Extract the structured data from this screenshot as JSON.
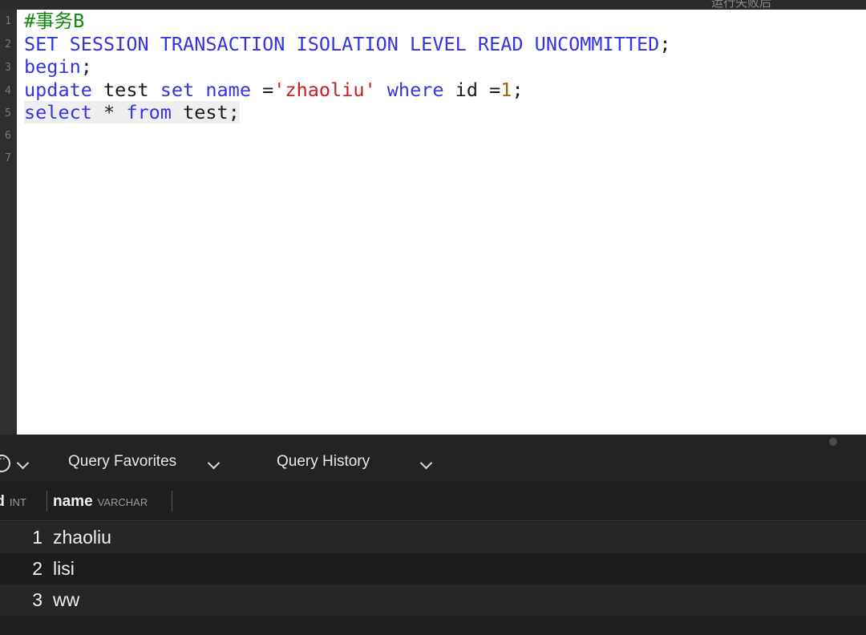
{
  "topbar": {
    "text": "运行失败后"
  },
  "editor": {
    "line_numbers": [
      "1",
      "2",
      "3",
      "4",
      "5",
      "6",
      "7"
    ],
    "lines": [
      [
        {
          "t": "#事务B",
          "c": "cm"
        }
      ],
      [
        {
          "t": "SET SESSION TRANSACTION ISOLATION LEVEL READ UNCOMMITTED",
          "c": "kw"
        },
        {
          "t": ";",
          "c": ""
        }
      ],
      [
        {
          "t": "begin",
          "c": "kw"
        },
        {
          "t": ";",
          "c": ""
        }
      ],
      [
        {
          "t": "update",
          "c": "kw"
        },
        {
          "t": " test ",
          "c": ""
        },
        {
          "t": "set",
          "c": "kw"
        },
        {
          "t": " ",
          "c": ""
        },
        {
          "t": "name",
          "c": "kw"
        },
        {
          "t": " =",
          "c": ""
        },
        {
          "t": "'zhaoliu'",
          "c": "str"
        },
        {
          "t": " ",
          "c": ""
        },
        {
          "t": "where",
          "c": "kw"
        },
        {
          "t": " id =",
          "c": ""
        },
        {
          "t": "1",
          "c": "num"
        },
        {
          "t": ";",
          "c": ""
        }
      ],
      [
        {
          "t": "select",
          "c": "kw"
        },
        {
          "t": " * ",
          "c": ""
        },
        {
          "t": "from",
          "c": "kw"
        },
        {
          "t": " test",
          "c": ""
        },
        {
          "t": ";",
          "c": ""
        }
      ],
      [],
      []
    ],
    "highlighted_line": 5
  },
  "toolbar": {
    "favorites_label": "Query Favorites",
    "history_label": "Query History"
  },
  "results": {
    "columns": [
      {
        "name": "id",
        "type": "INT"
      },
      {
        "name": "name",
        "type": "VARCHAR"
      }
    ],
    "rows": [
      {
        "id": "1",
        "name": "zhaoliu"
      },
      {
        "id": "2",
        "name": "lisi"
      },
      {
        "id": "3",
        "name": "ww"
      }
    ]
  },
  "icons": {
    "more": "more-options-icon",
    "chevron": "chevron-down-icon"
  }
}
